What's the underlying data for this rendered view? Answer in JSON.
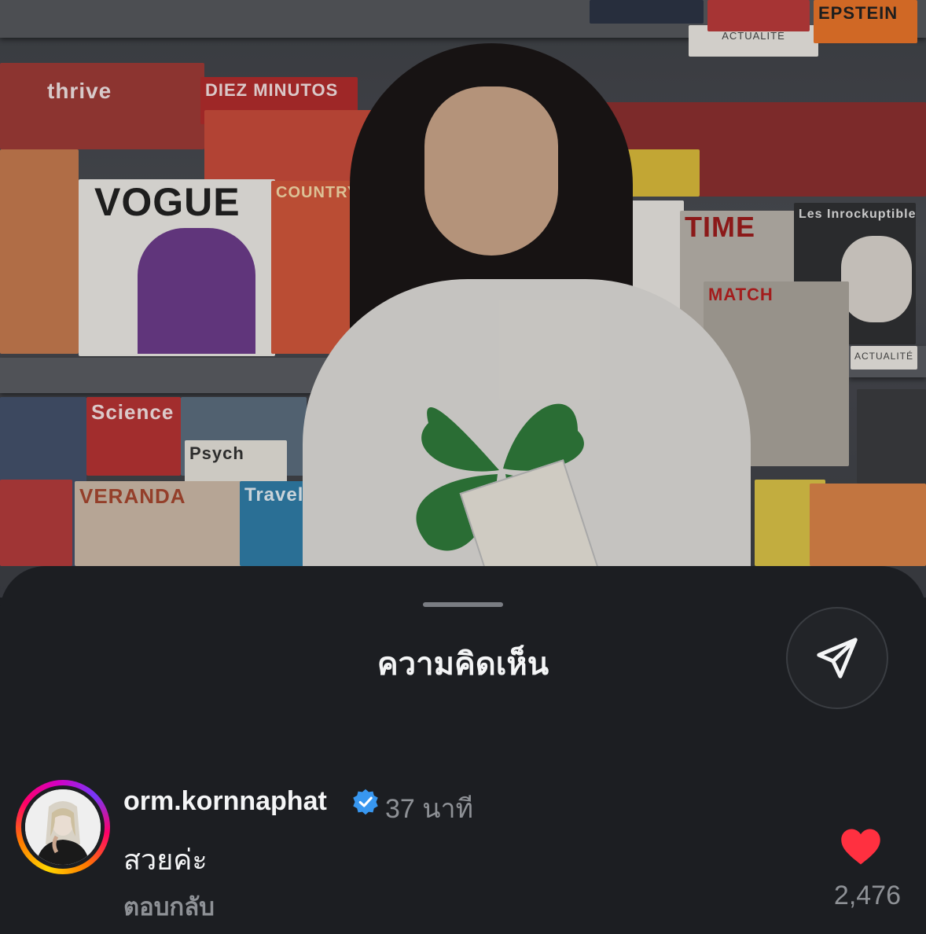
{
  "photo": {
    "shelf_tags": [
      "ACTUALITÉ",
      "ACTUALITÉ"
    ],
    "magazines": [
      "thrive",
      "DIEZ MINUTOS",
      "VOGUE",
      "COUNTRY LIVING",
      "TIME",
      "Les Inrockuptibles",
      "MATCH",
      "EPSTEIN",
      "Science",
      "VERANDA",
      "Travel",
      "Psych"
    ]
  },
  "sheet": {
    "title": "ความคิดเห็น",
    "share_icon": "paper-plane-icon"
  },
  "comment": {
    "username": "orm.kornnaphat",
    "verified_icon": "verified-badge-icon",
    "time": "37 นาที",
    "text": "สวยค่ะ",
    "reply_label": "ตอบกลับ",
    "like_icon": "heart-filled-icon",
    "like_color": "#ff3040",
    "like_count": "2,476"
  },
  "colors": {
    "sheet_bg": "#1c1e22",
    "primary_text": "#f4f5f6",
    "secondary_text": "#8e9196",
    "verified_blue": "#3897f0"
  }
}
